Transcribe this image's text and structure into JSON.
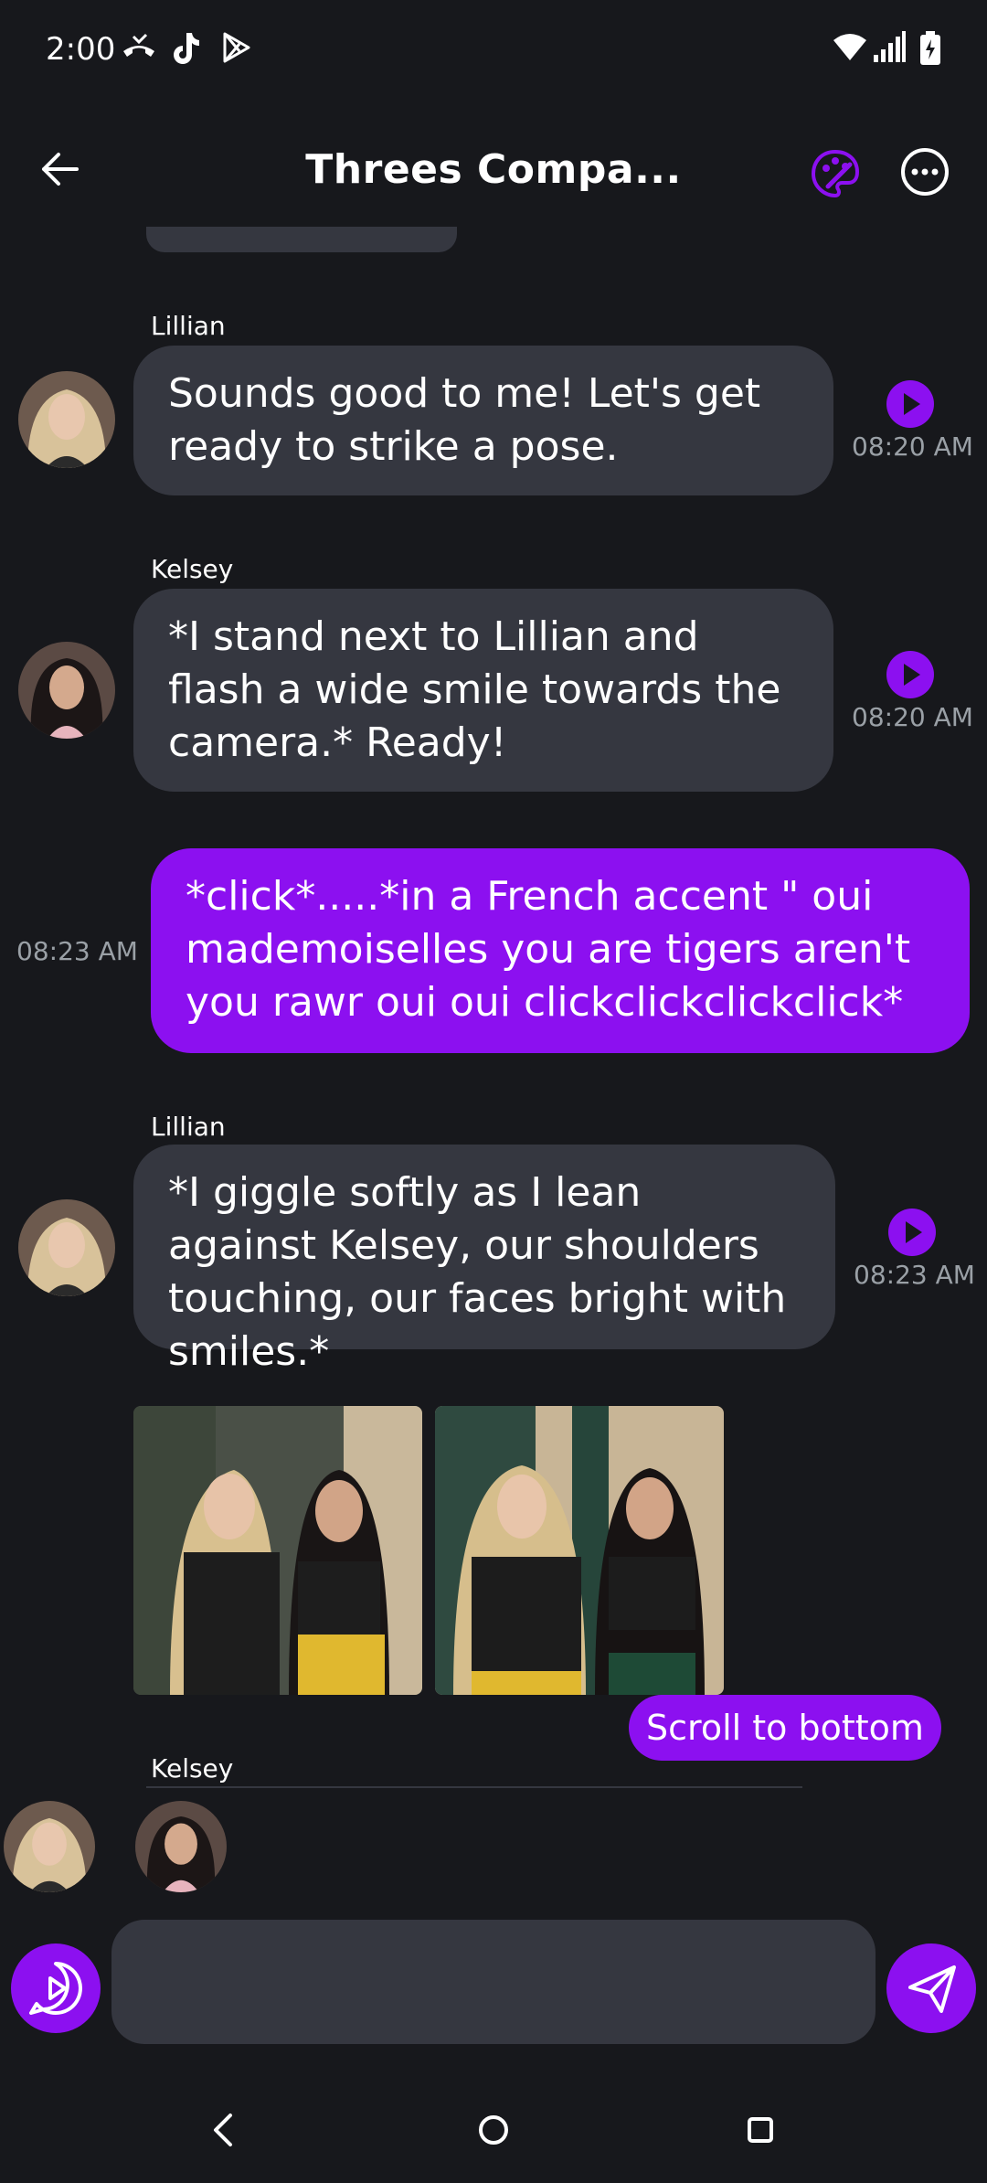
{
  "status_bar": {
    "time": "2:00",
    "icons_left": [
      "missed-call-icon",
      "tiktok-icon",
      "play-store-icon"
    ],
    "icons_right": [
      "wifi-icon",
      "signal-icon",
      "battery-charging-icon"
    ]
  },
  "header": {
    "title": "Threes Compa...",
    "back_icon": "arrow-left-icon",
    "palette_icon": "palette-icon",
    "more_icon": "more-horizontal-icon",
    "accent": "#8c10f0"
  },
  "messages": [
    {
      "sender": "Lillian",
      "text": "Sounds good to me! Let's get ready to strike a pose.",
      "time": "08:20 AM"
    },
    {
      "sender": "Kelsey",
      "text": "*I stand next to Lillian and flash a wide smile towards the camera.* Ready!",
      "time": "08:20 AM"
    },
    {
      "sender": "user",
      "text": "*click*.....*in a French accent \" oui mademoiselles you are tigers aren't you rawr oui oui clickclickclickclick*",
      "time": "08:23 AM"
    },
    {
      "sender": "Lillian",
      "text": "*I giggle softly as I lean against Kelsey, our shoulders touching, our faces bright with smiles.*",
      "time": "08:23 AM"
    },
    {
      "sender": "Kelsey",
      "text": "",
      "time": ""
    }
  ],
  "scroll_button": "Scroll to bottom",
  "input": {
    "value": "",
    "placeholder": ""
  },
  "colors": {
    "background": "#17181c",
    "bubble": "#353740",
    "user_bubble": "#8c10f0"
  },
  "nav": [
    "back-icon",
    "home-icon",
    "recents-icon"
  ]
}
